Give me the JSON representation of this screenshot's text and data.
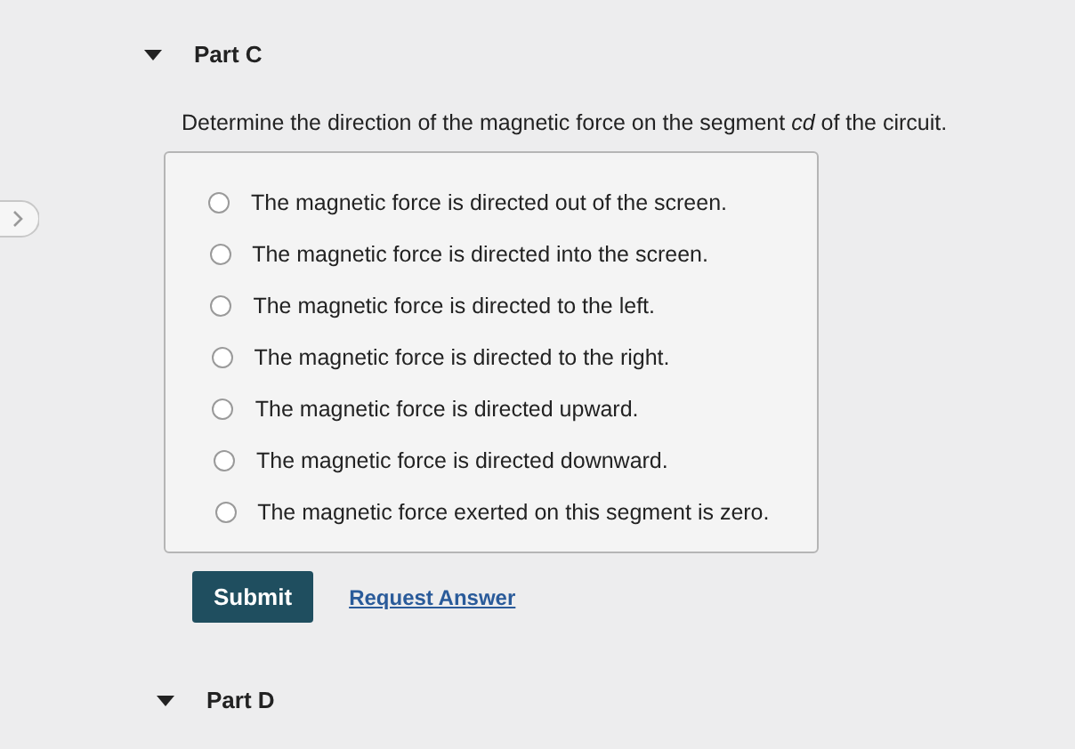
{
  "part_c": {
    "title": "Part C",
    "expanded": true
  },
  "question": "Determine the direction of the magnetic force on the segment *cd* of the circuit.",
  "options": [
    {
      "label": "The magnetic force is directed out of the screen.",
      "selected": false
    },
    {
      "label": "The magnetic force is directed into the screen.",
      "selected": false
    },
    {
      "label": "The magnetic force is directed to the left.",
      "selected": false
    },
    {
      "label": "The magnetic force is directed to the right.",
      "selected": false
    },
    {
      "label": "The magnetic force is directed upward.",
      "selected": false
    },
    {
      "label": "The magnetic force is directed downward.",
      "selected": false
    },
    {
      "label": "The magnetic force exerted on this segment is zero.",
      "selected": false
    }
  ],
  "submit": "Submit",
  "request_answer": "Request Answer",
  "part_d": {
    "title": "Part D",
    "expanded": true
  }
}
